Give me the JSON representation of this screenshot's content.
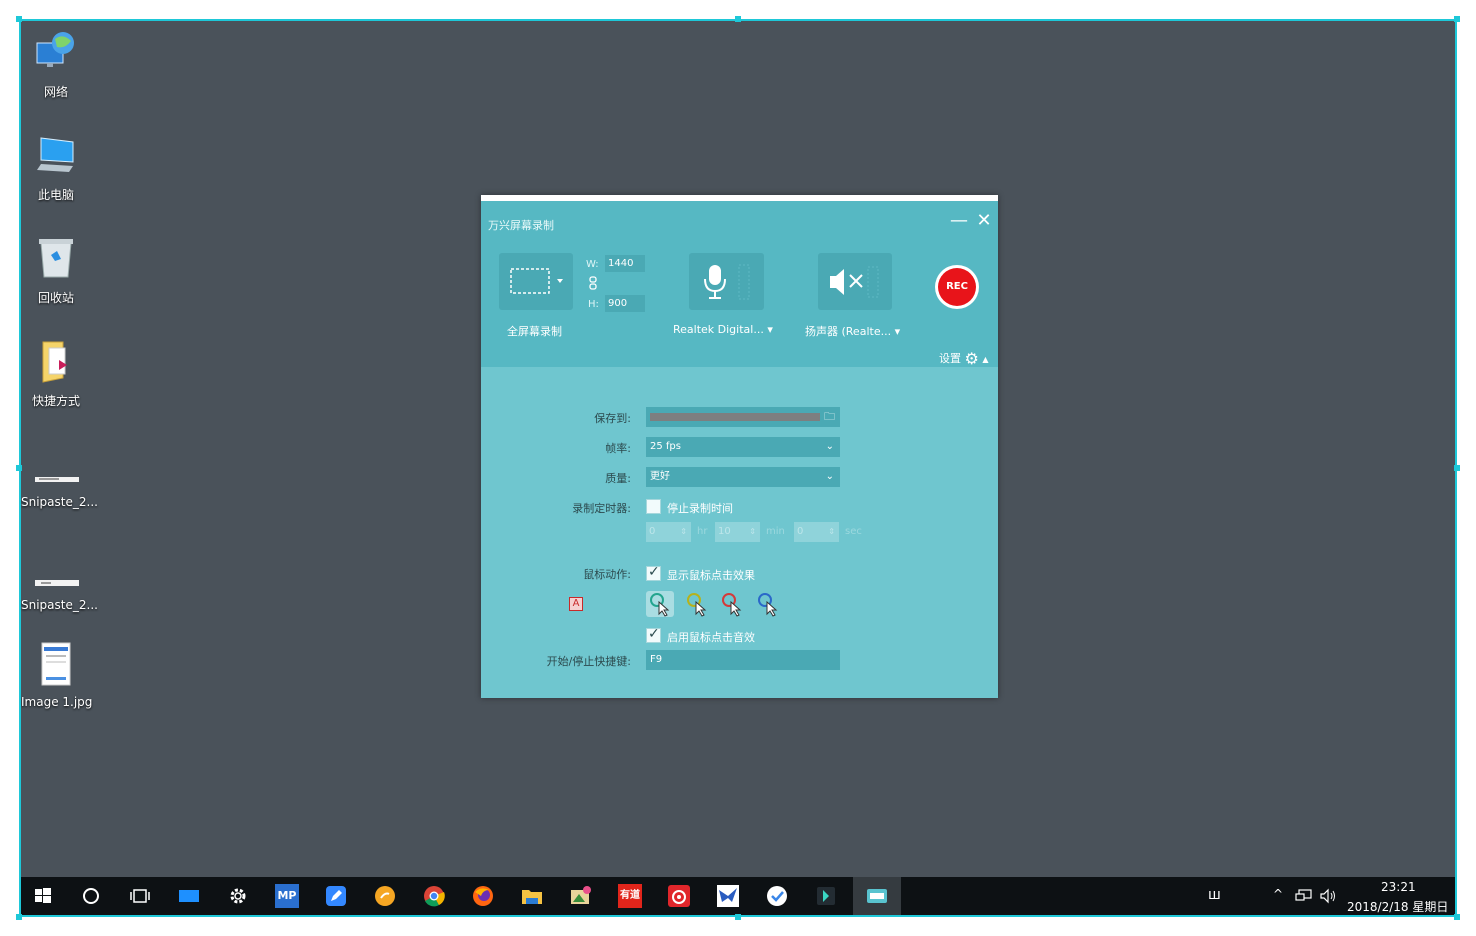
{
  "desktop": {
    "icons": [
      {
        "label": "网络",
        "icon": "network-globe-icon"
      },
      {
        "label": "此电脑",
        "icon": "computer-icon"
      },
      {
        "label": "回收站",
        "icon": "recycle-bin-icon"
      },
      {
        "label": "快捷方式",
        "icon": "shortcut-folder-icon"
      },
      {
        "label": "Snipaste_2...",
        "icon": "image-thumbnail-icon"
      },
      {
        "label": "Snipaste_2...",
        "icon": "image-thumbnail-icon"
      },
      {
        "label": "Image 1.jpg",
        "icon": "image-file-icon"
      }
    ]
  },
  "app": {
    "title": "万兴屏幕录制",
    "minimize_glyph": "—",
    "close_glyph": "✕",
    "capture": {
      "label": "全屏幕录制",
      "w_label": "W:",
      "w_value": "1440",
      "h_label": "H:",
      "h_value": "900"
    },
    "microphone": {
      "label": "Realtek Digital..."
    },
    "speaker": {
      "label": "扬声器 (Realte..."
    },
    "rec_label": "REC",
    "settings_label": "设置",
    "form": {
      "save_to_label": "保存到:",
      "save_to_value": "",
      "fps_label": "帧率:",
      "fps_value": "25 fps",
      "quality_label": "质量:",
      "quality_value": "更好",
      "timer_label": "录制定时器:",
      "timer_checkbox_label": "停止录制时间",
      "timer_checked": false,
      "hr_value": "0",
      "hr_unit": "hr",
      "min_value": "10",
      "min_unit": "min",
      "sec_value": "0",
      "sec_unit": "sec",
      "mouse_label": "鼠标动作:",
      "show_click_label": "显示鼠标点击效果",
      "show_click_checked": true,
      "click_sound_label": "启用鼠标点击音效",
      "click_sound_checked": true,
      "hotkey_label": "开始/停止快捷键:",
      "hotkey_value": "F9"
    },
    "cursor_colors": [
      "#23a58f",
      "#b6b21d",
      "#d43a3a",
      "#2a68c9"
    ]
  },
  "taskbar": {
    "icons": [
      "windows-start-icon",
      "cortana-circle-icon",
      "task-view-icon",
      "desktop-display-icon",
      "settings-gear-icon",
      "mp-app-icon",
      "feishu-pen-icon",
      "fruit-app-icon",
      "chrome-icon",
      "firefox-icon",
      "file-explorer-icon",
      "photo-editor-icon",
      "youdao-icon",
      "netease-music-icon",
      "bird-app-icon",
      "check-app-icon",
      "filmora-icon",
      "screen-recorder-icon"
    ],
    "youdao_text": "有道",
    "mp_text": "MP",
    "ime_text": "ш",
    "time": "23:21",
    "date": "2018/2/18 星期日",
    "tray_up": "^"
  }
}
